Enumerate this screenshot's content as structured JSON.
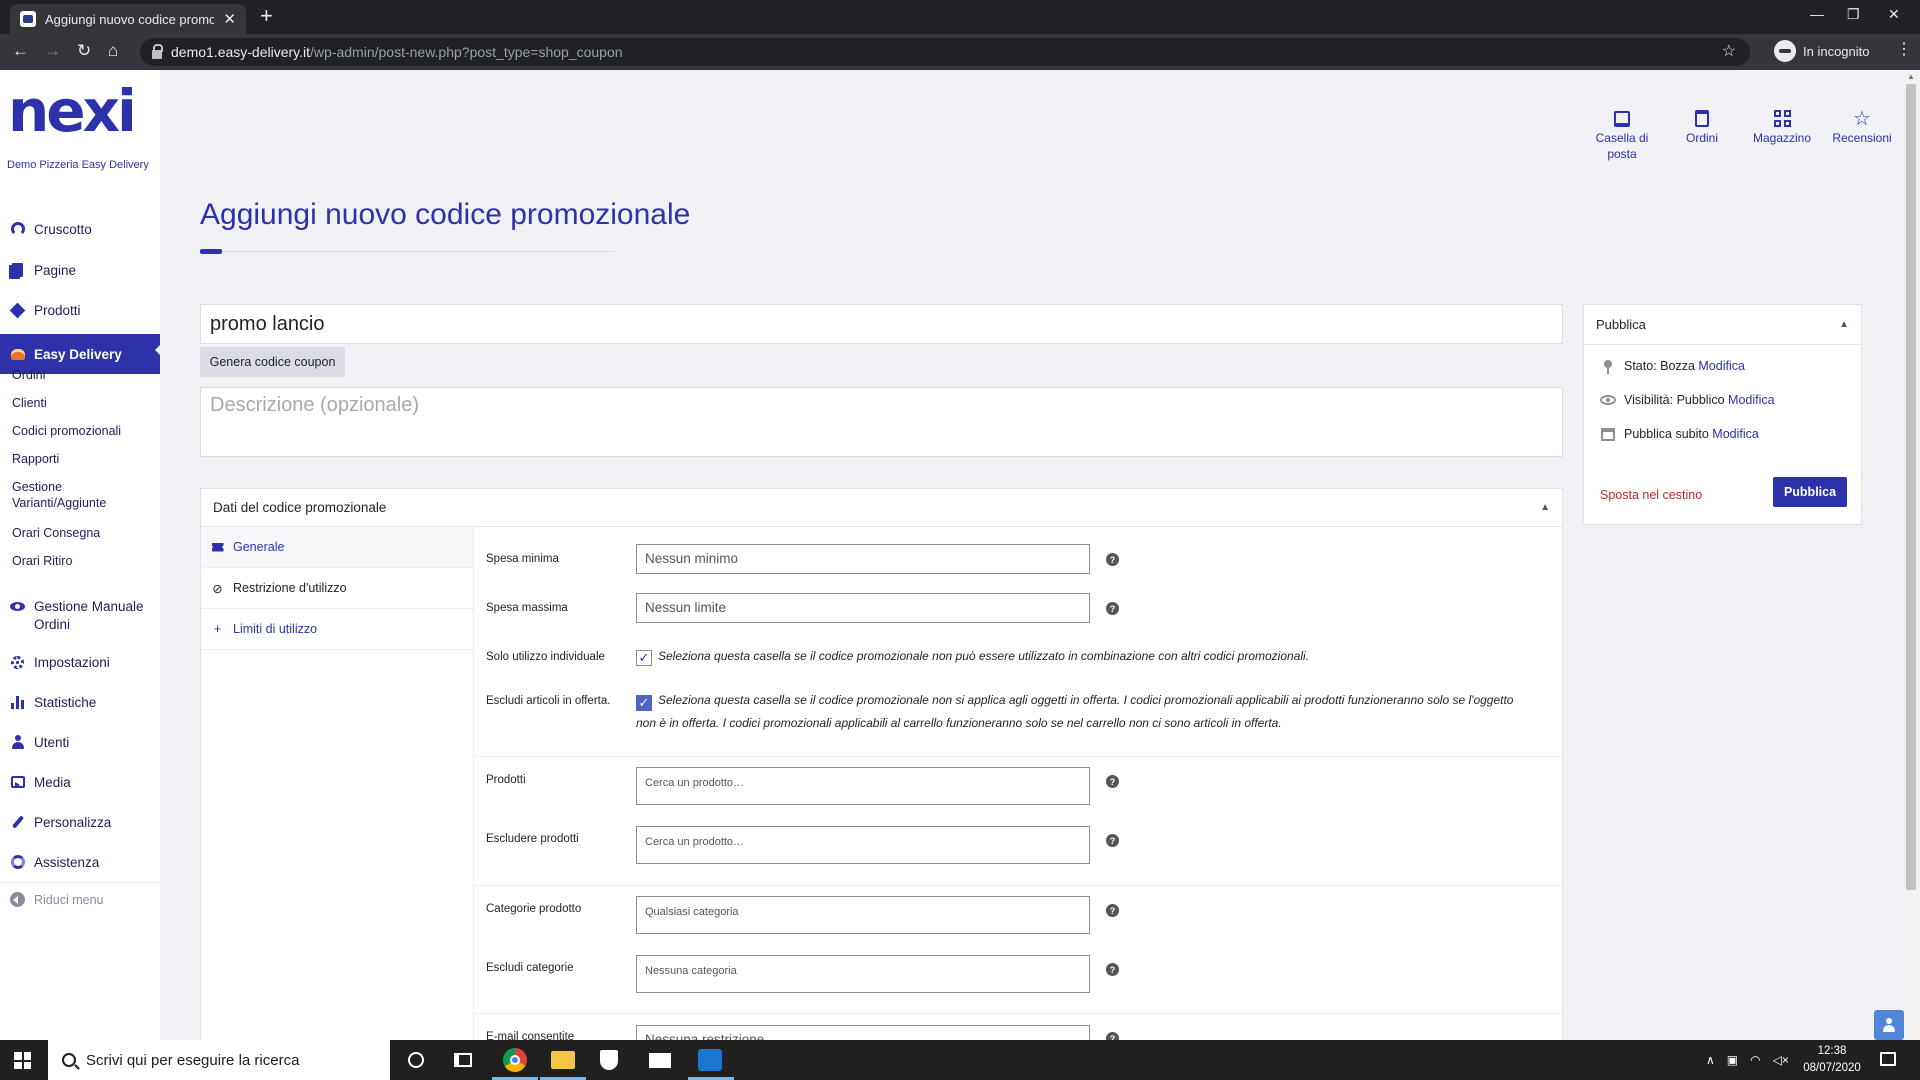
{
  "browser": {
    "tab_title": "Aggiungi nuovo codice promozionale",
    "url_host": "demo1.easy-delivery.it",
    "url_path": "/wp-admin/post-new.php?post_type=shop_coupon",
    "incognito_label": "In incognito"
  },
  "sidebar": {
    "logo": "nexi",
    "site_name": "Demo Pizzeria Easy Delivery",
    "items": [
      {
        "label": "Cruscotto",
        "icon": "dashboard-icon"
      },
      {
        "label": "Pagine",
        "icon": "pages-icon"
      },
      {
        "label": "Prodotti",
        "icon": "products-icon"
      },
      {
        "label": "Easy Delivery",
        "icon": "burger-icon"
      },
      {
        "label": "Gestione Manuale Ordini",
        "icon": "eye-icon"
      },
      {
        "label": "Impostazioni",
        "icon": "gear-icon"
      },
      {
        "label": "Statistiche",
        "icon": "bar-chart-icon"
      },
      {
        "label": "Utenti",
        "icon": "user-icon"
      },
      {
        "label": "Media",
        "icon": "media-icon"
      },
      {
        "label": "Personalizza",
        "icon": "brush-icon"
      },
      {
        "label": "Assistenza",
        "icon": "help-icon"
      }
    ],
    "submenu": [
      "Ordini",
      "Clienti",
      "Codici promozionali",
      "Rapporti",
      "Gestione Varianti/Aggiunte",
      "Orari Consegna",
      "Orari Ritiro"
    ],
    "collapse_label": "Riduci menu"
  },
  "topbar": {
    "items": [
      {
        "label": "Casella di posta",
        "icon": "inbox-icon"
      },
      {
        "label": "Ordini",
        "icon": "orders-icon"
      },
      {
        "label": "Magazzino",
        "icon": "warehouse-icon"
      },
      {
        "label": "Recensioni",
        "icon": "star-icon"
      }
    ]
  },
  "page": {
    "title": "Aggiungi nuovo codice promozionale",
    "coupon_code_value": "promo lancio",
    "generate_button": "Genera codice coupon",
    "description_placeholder": "Descrizione (opzionale)"
  },
  "coupon_data": {
    "heading": "Dati del codice promozionale",
    "tabs": [
      "Generale",
      "Restrizione d'utilizzo",
      "Limiti di utilizzo"
    ],
    "fields": {
      "min_spend_label": "Spesa minima",
      "min_spend_placeholder": "Nessun minimo",
      "max_spend_label": "Spesa massima",
      "max_spend_placeholder": "Nessun limite",
      "individual_label": "Solo utilizzo individuale",
      "individual_text": "Seleziona questa casella se il codice promozionale non può essere utilizzato in combinazione con altri codici promozionali.",
      "individual_checked": true,
      "exclude_sale_label": "Escludi articoli in offerta.",
      "exclude_sale_text": "Seleziona questa casella se il codice promozionale non si applica agli oggetti in offerta. I codici promozionali applicabili ai prodotti funzioneranno solo se l'oggetto non è in offerta. I codici promozionali applicabili al carrello funzioneranno solo se nel carrello non ci sono articoli in offerta.",
      "exclude_sale_checked": true,
      "products_label": "Prodotti",
      "products_placeholder": "Cerca un prodotto…",
      "exclude_products_label": "Escludere prodotti",
      "exclude_products_placeholder": "Cerca un prodotto…",
      "categories_label": "Categorie prodotto",
      "categories_placeholder": "Qualsiasi categoria",
      "exclude_categories_label": "Escludi categorie",
      "exclude_categories_placeholder": "Nessuna categoria",
      "emails_label": "E-mail consentite",
      "emails_placeholder": "Nessuna restrizione"
    }
  },
  "publish": {
    "heading": "Pubblica",
    "status_label": "Stato:",
    "status_value": "Bozza",
    "visibility_label": "Visibilità:",
    "visibility_value": "Pubblico",
    "schedule_label": "Pubblica",
    "schedule_value": "subito",
    "edit_link": "Modifica",
    "trash_link": "Sposta nel cestino",
    "publish_button": "Pubblica"
  },
  "taskbar": {
    "search_placeholder": "Scrivi qui per eseguire la ricerca",
    "time": "12:38",
    "date": "08/07/2020"
  },
  "colors": {
    "brand": "#2d32aa",
    "trash": "#b32d2e",
    "checkbox": "#4f64c4"
  }
}
